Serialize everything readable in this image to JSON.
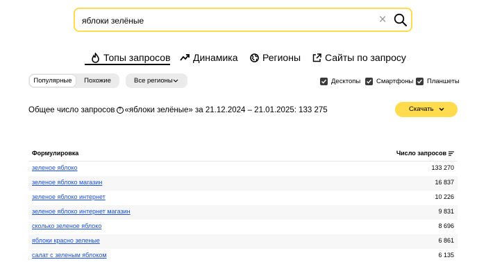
{
  "search": {
    "value": "яблоки зелёные"
  },
  "tabs": [
    {
      "label": "Топы запросов",
      "icon": "flame-icon",
      "active": true
    },
    {
      "label": "Динамика",
      "icon": "trend-icon"
    },
    {
      "label": "Регионы",
      "icon": "globe-icon"
    },
    {
      "label": "Сайты по запросу",
      "icon": "external-link-icon"
    }
  ],
  "filters": {
    "popular": "Популярные",
    "similar": "Похожие",
    "regions": "Все регионы",
    "devices": [
      "Десктопы",
      "Смартфоны",
      "Планшеты"
    ]
  },
  "summary": {
    "prefix": "Общее число запросов",
    "text": "«яблоки зелёные» за 21.12.2024 – 21.01.2025: 133 275"
  },
  "download": {
    "label": "Скачать"
  },
  "table": {
    "col_phrase": "Формулировка",
    "col_count": "Число запросов",
    "rows": [
      {
        "phrase": "зеленое яблоко",
        "count": "133 270"
      },
      {
        "phrase": "зеленое яблоко магазин",
        "count": "16 837"
      },
      {
        "phrase": "зеленое яблоко интернет",
        "count": "10 226"
      },
      {
        "phrase": "зеленое яблоко интернет магазин",
        "count": "9 831"
      },
      {
        "phrase": "сколько зеленое яблоко",
        "count": "8 696"
      },
      {
        "phrase": "яблоки красно зеленые",
        "count": "6 861"
      },
      {
        "phrase": "салат с зеленым яблоком",
        "count": "6 135"
      }
    ]
  },
  "colors": {
    "accent": "#ffdb4d",
    "link": "#1a4fdb"
  }
}
